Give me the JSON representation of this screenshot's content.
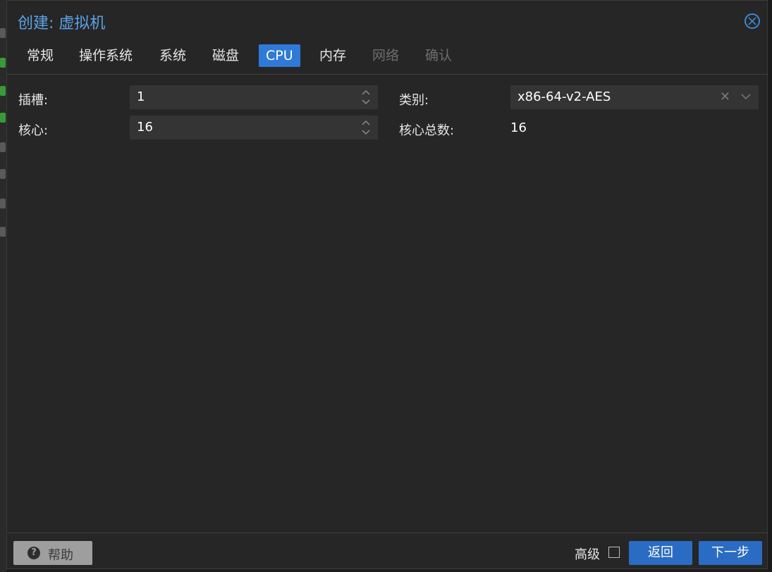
{
  "dialog": {
    "title": "创建: 虚拟机"
  },
  "tabs": [
    {
      "label": "常规",
      "state": "normal"
    },
    {
      "label": "操作系统",
      "state": "normal"
    },
    {
      "label": "系统",
      "state": "normal"
    },
    {
      "label": "磁盘",
      "state": "normal"
    },
    {
      "label": "CPU",
      "state": "active"
    },
    {
      "label": "内存",
      "state": "normal"
    },
    {
      "label": "网络",
      "state": "disabled"
    },
    {
      "label": "确认",
      "state": "disabled"
    }
  ],
  "form": {
    "sockets_label": "插槽:",
    "sockets_value": "1",
    "cores_label": "核心:",
    "cores_value": "16",
    "type_label": "类别:",
    "type_value": "x86-64-v2-AES",
    "total_cores_label": "核心总数:",
    "total_cores_value": "16"
  },
  "footer": {
    "help_label": "帮助",
    "advanced_label": "高级",
    "advanced_checked": false,
    "back_label": "返回",
    "next_label": "下一步"
  },
  "colors": {
    "accent": "#2f7ad9",
    "title": "#5aa3e6",
    "button_primary": "#2a6cc4",
    "background": "#262626"
  }
}
